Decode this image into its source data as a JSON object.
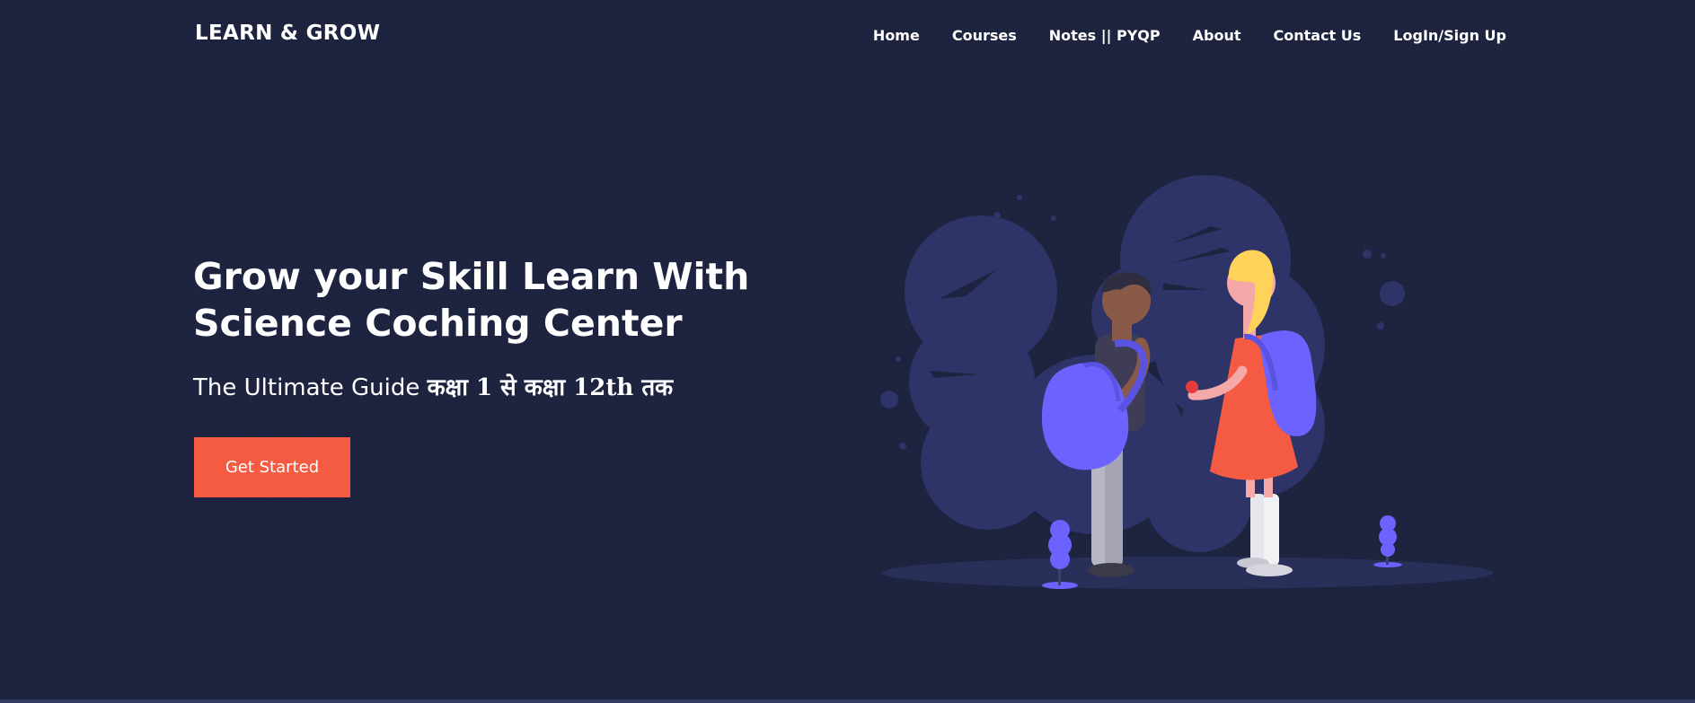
{
  "brand": {
    "name": "LEARN & GROW"
  },
  "nav": {
    "items": [
      {
        "label": "Home"
      },
      {
        "label": "Courses"
      },
      {
        "label": "Notes || PYQP"
      },
      {
        "label": "About"
      },
      {
        "label": "Contact Us"
      },
      {
        "label": "LogIn/Sign Up"
      }
    ]
  },
  "hero": {
    "title_line1": "Grow your Skill Learn With",
    "title_line2": "Science Coching Center",
    "subtitle_prefix": "The Ultimate Guide",
    "subtitle_hindi": "कक्षा 1 से कक्षा 12th तक",
    "cta_label": "Get Started"
  },
  "colors": {
    "background": "#1e2440",
    "accent": "#f55a42",
    "illustration_blob": "#2e3467",
    "illustration_purple": "#6c63ff"
  },
  "illustration": {
    "icon": "students-with-backpacks-illustration"
  }
}
